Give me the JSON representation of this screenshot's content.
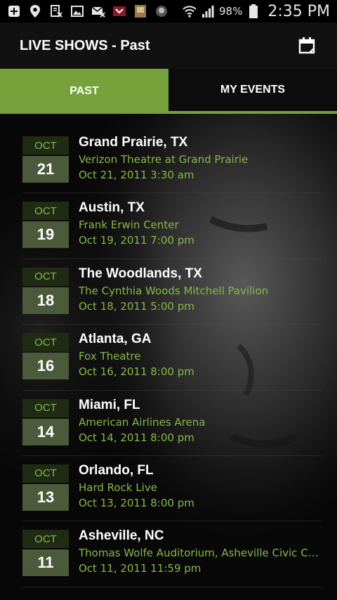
{
  "status_bar": {
    "battery_percent": "98%",
    "time": "2:35 PM",
    "icons": [
      "add-icon",
      "location-icon",
      "file-x-icon",
      "image-icon",
      "mail-x-icon",
      "app-icon-1",
      "app-icon-2",
      "app-icon-3",
      "wifi-icon",
      "signal-icon",
      "battery-icon"
    ]
  },
  "app_bar": {
    "title": "LIVE SHOWS - Past",
    "action_icon": "calendar-icon"
  },
  "tabs": [
    {
      "label": "PAST",
      "active": true
    },
    {
      "label": "MY EVENTS",
      "active": false
    }
  ],
  "colors": {
    "accent": "#76a23c",
    "text_green": "#86b84a",
    "background": "#000000"
  },
  "shows": [
    {
      "month": "OCT",
      "day": "21",
      "city": "Grand Prairie, TX",
      "venue": "Verizon Theatre at Grand Prairie",
      "datetime": "Oct 21, 2011 3:30 am"
    },
    {
      "month": "OCT",
      "day": "19",
      "city": "Austin, TX",
      "venue": "Frank Erwin Center",
      "datetime": "Oct 19, 2011 7:00 pm"
    },
    {
      "month": "OCT",
      "day": "18",
      "city": "The Woodlands, TX",
      "venue": "The Cynthia Woods Mitchell Pavilion",
      "datetime": "Oct 18, 2011 5:00 pm"
    },
    {
      "month": "OCT",
      "day": "16",
      "city": "Atlanta, GA",
      "venue": "Fox Theatre",
      "datetime": "Oct 16, 2011 8:00 pm"
    },
    {
      "month": "OCT",
      "day": "14",
      "city": "Miami, FL",
      "venue": "American Airlines Arena",
      "datetime": "Oct 14, 2011 8:00 pm"
    },
    {
      "month": "OCT",
      "day": "13",
      "city": "Orlando, FL",
      "venue": "Hard Rock Live",
      "datetime": "Oct 13, 2011 8:00 pm"
    },
    {
      "month": "OCT",
      "day": "11",
      "city": "Asheville, NC",
      "venue": "Thomas Wolfe Auditorium, Asheville Civic Ce...",
      "datetime": "Oct 11, 2011 11:59 pm"
    }
  ]
}
